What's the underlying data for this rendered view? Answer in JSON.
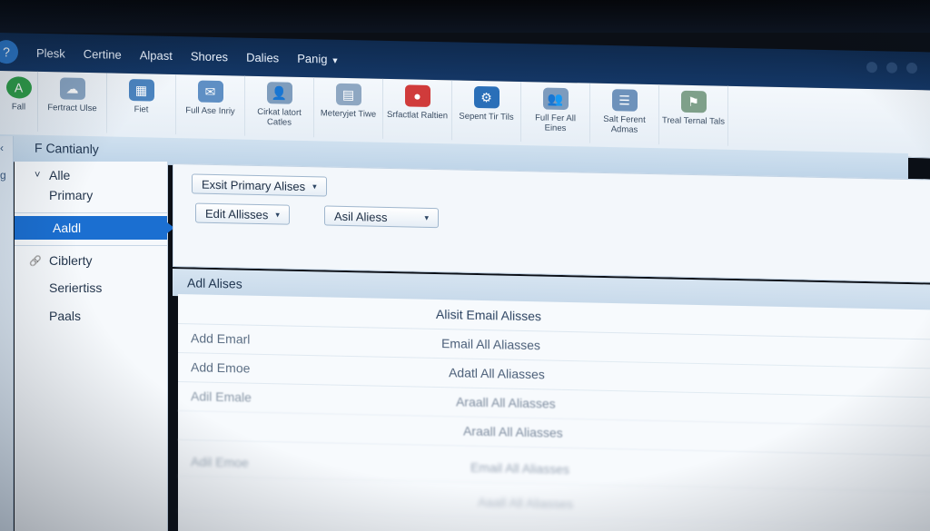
{
  "menubar": {
    "items": [
      "Plesk",
      "Certine",
      "Alpast",
      "Shores",
      "Dalies",
      "Panig"
    ]
  },
  "toolbar": {
    "tools": [
      {
        "label": "Fall",
        "icon": "green-badge-icon",
        "color": "#2fa04a"
      },
      {
        "label": "Fertract Ulse",
        "icon": "cloud-icon",
        "color": "#8aa6c4"
      },
      {
        "label": "Fiet",
        "icon": "grid-icon",
        "color": "#4b84c0"
      },
      {
        "label": "Full Ase Inriy",
        "icon": "mail-icon",
        "color": "#5f8fc4"
      },
      {
        "label": "Cirkat latort Catles",
        "icon": "user-icon",
        "color": "#7f9dbd"
      },
      {
        "label": "Meteryjet Tiwe",
        "icon": "document-icon",
        "color": "#8ea7c2"
      },
      {
        "label": "Srfactlat Raltien",
        "icon": "red-circle-icon",
        "color": "#d03b3b"
      },
      {
        "label": "Sepent Tir Tils",
        "icon": "gear-icon",
        "color": "#2a6fb8"
      },
      {
        "label": "Full Fer All Eines",
        "icon": "users-icon",
        "color": "#7d9bbd"
      },
      {
        "label": "Salt Ferent Admas",
        "icon": "list-icon",
        "color": "#6e92bb"
      },
      {
        "label": "Treal Ternal Tals",
        "icon": "tag-icon",
        "color": "#7fa08a"
      }
    ]
  },
  "sidebar": {
    "header": "F Cantianly",
    "items": [
      {
        "label": "Alle",
        "prefix": "˅"
      },
      {
        "label": "Primary",
        "prefix": ""
      },
      {
        "label": "Aaldl",
        "prefix": ""
      },
      {
        "label": "Ciblerty",
        "prefix": "🔗"
      },
      {
        "label": "Seriertiss",
        "prefix": ""
      },
      {
        "label": "Paals",
        "prefix": ""
      }
    ]
  },
  "panel": {
    "dropdown_primary": "Exsit Primary Alises",
    "dropdown_edit": "Edit Allisses",
    "dropdown_asil": "Asil Aliess"
  },
  "section": {
    "title": "Adl Alises"
  },
  "list": {
    "header_mid": "Alisit Email Alisses",
    "rows": [
      {
        "left": "Add Emarl",
        "mid": "Email All Aliasses"
      },
      {
        "left": "Add Emoe",
        "mid": "Adatl All Aliasses"
      },
      {
        "left": "Adil Emale",
        "mid": "Araall All Aliasses"
      },
      {
        "left": "",
        "mid": "Araall All Aliasses"
      },
      {
        "left": "Adil Emoe",
        "mid": "Email All Aliasses"
      },
      {
        "left": "",
        "mid": "Aaall All Aliasses"
      }
    ]
  }
}
